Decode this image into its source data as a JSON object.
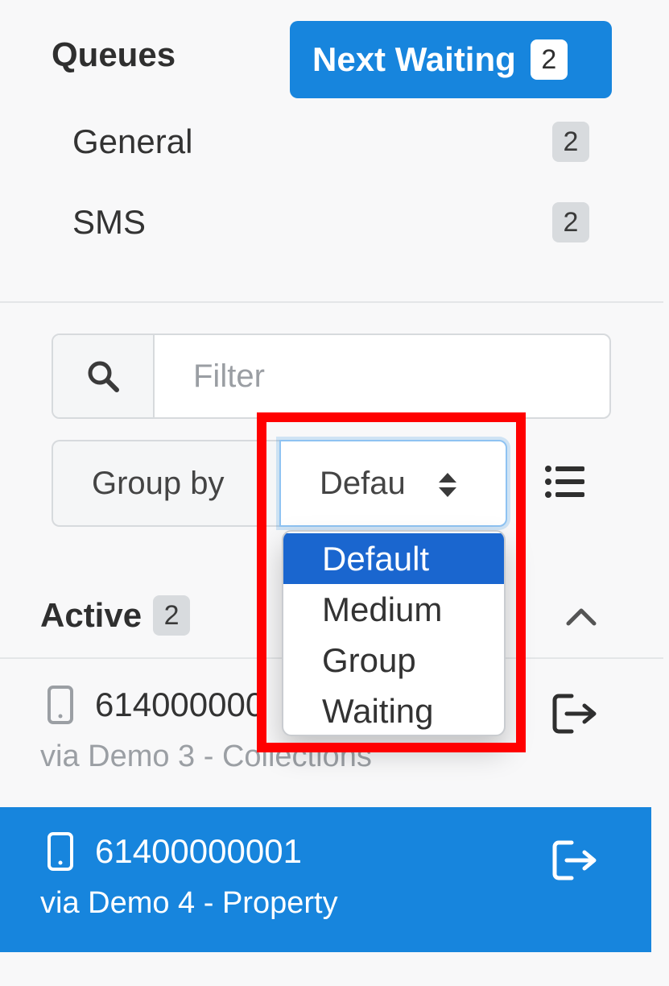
{
  "queues": {
    "title": "Queues",
    "next_waiting_label": "Next Waiting",
    "next_waiting_count": "2",
    "items": [
      {
        "label": "General",
        "count": "2"
      },
      {
        "label": "SMS",
        "count": "2"
      }
    ]
  },
  "filter": {
    "placeholder": "Filter",
    "icon": "search-icon"
  },
  "group_by": {
    "label": "Group by",
    "selected_display": "Defau",
    "options": [
      "Default",
      "Medium",
      "Group",
      "Waiting"
    ],
    "selected_index": 0
  },
  "active": {
    "title": "Active",
    "count": "2"
  },
  "conversations": [
    {
      "number": "614000000",
      "via": "via Demo 3 - Collections",
      "selected": false
    },
    {
      "number": "61400000001",
      "via": "via Demo 4 - Property",
      "selected": true
    }
  ],
  "colors": {
    "primary": "#1785dd",
    "selected_option": "#1a66cf",
    "highlight": "#ff0000",
    "badge": "#d8dbde"
  }
}
